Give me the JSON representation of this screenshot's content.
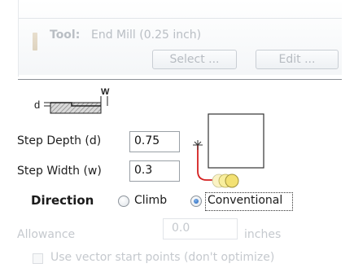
{
  "tool": {
    "label": "Tool:",
    "value": "End Mill (0.25 inch)",
    "select_button": "Select ...",
    "edit_button": "Edit ..."
  },
  "diagram": {
    "depth_letter": "d",
    "width_letter": "W"
  },
  "step_depth": {
    "label": "Step Depth (d)",
    "value": "0.75"
  },
  "step_width": {
    "label": "Step Width (w)",
    "value": "0.3"
  },
  "direction": {
    "label": "Direction",
    "options": [
      {
        "label": "Climb",
        "selected": false
      },
      {
        "label": "Conventional",
        "selected": true
      }
    ]
  },
  "allowance": {
    "label": "Allowance",
    "value": "0.0",
    "unit": "inches"
  },
  "vector_start": {
    "label": "Use vector start points (don't optimize)",
    "checked": false
  },
  "colors": {
    "toolpath_red": "#d42020",
    "tool_circle_yellow": "#f3e173"
  }
}
